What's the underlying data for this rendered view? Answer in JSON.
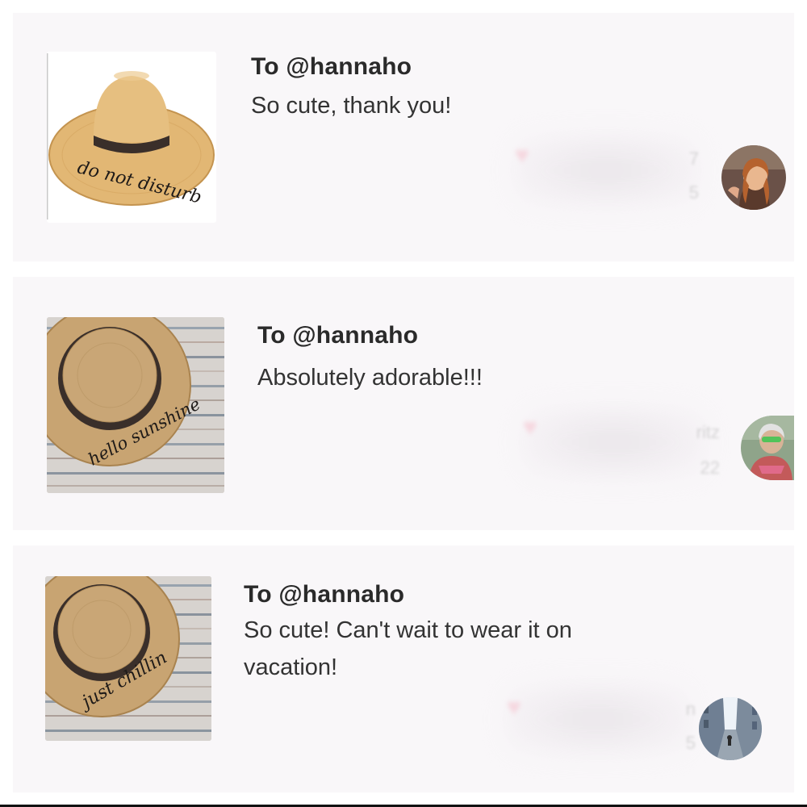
{
  "comments": [
    {
      "recipient": "To @hannaho",
      "message": "So cute, thank you!",
      "hat_text": "do not disturb",
      "ghost_name": "7",
      "ghost_time": "5"
    },
    {
      "recipient": "To @hannaho",
      "message": "Absolutely adorable!!!",
      "hat_text": "hello sunshine",
      "ghost_name": "ritz",
      "ghost_time": "22"
    },
    {
      "recipient": "To @hannaho",
      "message": "So cute! Can't wait to wear it on vacation!",
      "hat_text": "just chillin",
      "ghost_name": "n",
      "ghost_time": "5"
    }
  ],
  "icons": {
    "like": "heart-icon"
  },
  "colors": {
    "card_bg": "#f9f7f9",
    "straw": "#d9ad6c",
    "band": "#3a2f2a",
    "heart": "#f5a3b5"
  }
}
